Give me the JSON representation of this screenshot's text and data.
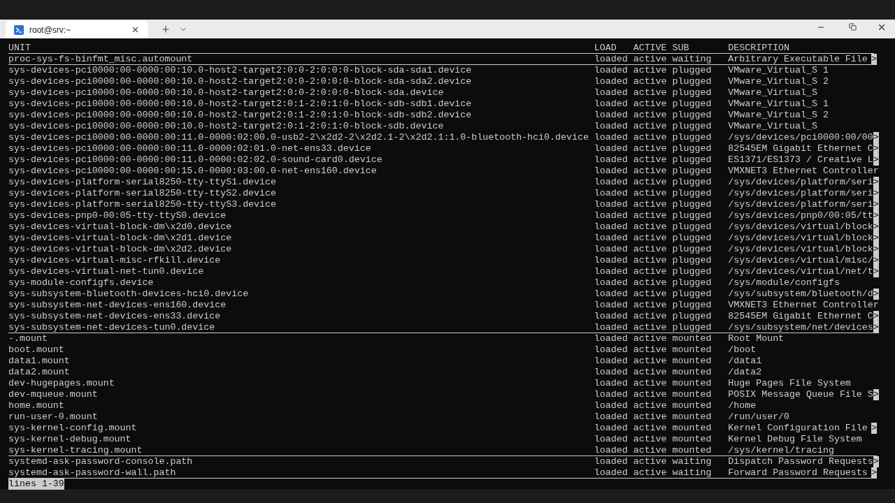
{
  "tab": {
    "title": "root@srv:~",
    "selected": true
  },
  "table": {
    "columns": [
      "UNIT",
      "LOAD",
      "ACTIVE",
      "SUB",
      "DESCRIPTION"
    ],
    "header_underlined": true,
    "rows": [
      {
        "unit": "proc-sys-fs-binfmt_misc.automount",
        "load": "loaded",
        "active": "active",
        "sub": "waiting",
        "description": "Arbitrary Executable File",
        "more": ">",
        "underlined": true
      },
      {
        "unit": "sys-devices-pci0000:00-0000:00:10.0-host2-target2:0:0-2:0:0:0-block-sda-sda1.device",
        "load": "loaded",
        "active": "active",
        "sub": "plugged",
        "description": "VMware_Virtual_S 1",
        "underlined": false
      },
      {
        "unit": "sys-devices-pci0000:00-0000:00:10.0-host2-target2:0:0-2:0:0:0-block-sda-sda2.device",
        "load": "loaded",
        "active": "active",
        "sub": "plugged",
        "description": "VMware_Virtual_S 2",
        "underlined": false
      },
      {
        "unit": "sys-devices-pci0000:00-0000:00:10.0-host2-target2:0:0-2:0:0:0-block-sda.device",
        "load": "loaded",
        "active": "active",
        "sub": "plugged",
        "description": "VMware_Virtual_S",
        "underlined": false
      },
      {
        "unit": "sys-devices-pci0000:00-0000:00:10.0-host2-target2:0:1-2:0:1:0-block-sdb-sdb1.device",
        "load": "loaded",
        "active": "active",
        "sub": "plugged",
        "description": "VMware_Virtual_S 1",
        "underlined": false
      },
      {
        "unit": "sys-devices-pci0000:00-0000:00:10.0-host2-target2:0:1-2:0:1:0-block-sdb-sdb2.device",
        "load": "loaded",
        "active": "active",
        "sub": "plugged",
        "description": "VMware_Virtual_S 2",
        "underlined": false
      },
      {
        "unit": "sys-devices-pci0000:00-0000:00:10.0-host2-target2:0:1-2:0:1:0-block-sdb.device",
        "load": "loaded",
        "active": "active",
        "sub": "plugged",
        "description": "VMware_Virtual_S",
        "underlined": false
      },
      {
        "unit": "sys-devices-pci0000:00-0000:00:11.0-0000:02:00.0-usb2-2\\x2d2-2\\x2d2.1-2\\x2d2.1:1.0-bluetooth-hci0.device",
        "load": "loaded",
        "active": "active",
        "sub": "plugged",
        "description": "/sys/devices/pci0000:00/00",
        "more": ">",
        "underlined": false
      },
      {
        "unit": "sys-devices-pci0000:00-0000:00:11.0-0000:02:01.0-net-ens33.device",
        "load": "loaded",
        "active": "active",
        "sub": "plugged",
        "description": "82545EM Gigabit Ethernet C",
        "more": ">",
        "underlined": false
      },
      {
        "unit": "sys-devices-pci0000:00-0000:00:11.0-0000:02:02.0-sound-card0.device",
        "load": "loaded",
        "active": "active",
        "sub": "plugged",
        "description": "ES1371/ES1373 / Creative L",
        "more": ">",
        "underlined": false
      },
      {
        "unit": "sys-devices-pci0000:00-0000:00:15.0-0000:03:00.0-net-ens160.device",
        "load": "loaded",
        "active": "active",
        "sub": "plugged",
        "description": "VMXNET3 Ethernet Controller",
        "underlined": false
      },
      {
        "unit": "sys-devices-platform-serial8250-tty-ttyS1.device",
        "load": "loaded",
        "active": "active",
        "sub": "plugged",
        "description": "/sys/devices/platform/seri",
        "more": ">",
        "underlined": false
      },
      {
        "unit": "sys-devices-platform-serial8250-tty-ttyS2.device",
        "load": "loaded",
        "active": "active",
        "sub": "plugged",
        "description": "/sys/devices/platform/seri",
        "more": ">",
        "underlined": false
      },
      {
        "unit": "sys-devices-platform-serial8250-tty-ttyS3.device",
        "load": "loaded",
        "active": "active",
        "sub": "plugged",
        "description": "/sys/devices/platform/seri",
        "more": ">",
        "underlined": false
      },
      {
        "unit": "sys-devices-pnp0-00:05-tty-ttyS0.device",
        "load": "loaded",
        "active": "active",
        "sub": "plugged",
        "description": "/sys/devices/pnp0/00:05/tt",
        "more": ">",
        "underlined": false
      },
      {
        "unit": "sys-devices-virtual-block-dm\\x2d0.device",
        "load": "loaded",
        "active": "active",
        "sub": "plugged",
        "description": "/sys/devices/virtual/block",
        "more": ">",
        "underlined": false
      },
      {
        "unit": "sys-devices-virtual-block-dm\\x2d1.device",
        "load": "loaded",
        "active": "active",
        "sub": "plugged",
        "description": "/sys/devices/virtual/block",
        "more": ">",
        "underlined": false
      },
      {
        "unit": "sys-devices-virtual-block-dm\\x2d2.device",
        "load": "loaded",
        "active": "active",
        "sub": "plugged",
        "description": "/sys/devices/virtual/block",
        "more": ">",
        "underlined": false
      },
      {
        "unit": "sys-devices-virtual-misc-rfkill.device",
        "load": "loaded",
        "active": "active",
        "sub": "plugged",
        "description": "/sys/devices/virtual/misc/",
        "more": ">",
        "underlined": false
      },
      {
        "unit": "sys-devices-virtual-net-tun0.device",
        "load": "loaded",
        "active": "active",
        "sub": "plugged",
        "description": "/sys/devices/virtual/net/t",
        "more": ">",
        "underlined": false
      },
      {
        "unit": "sys-module-configfs.device",
        "load": "loaded",
        "active": "active",
        "sub": "plugged",
        "description": "/sys/module/configfs",
        "underlined": false
      },
      {
        "unit": "sys-subsystem-bluetooth-devices-hci0.device",
        "load": "loaded",
        "active": "active",
        "sub": "plugged",
        "description": "/sys/subsystem/bluetooth/d",
        "more": ">",
        "underlined": false
      },
      {
        "unit": "sys-subsystem-net-devices-ens160.device",
        "load": "loaded",
        "active": "active",
        "sub": "plugged",
        "description": "VMXNET3 Ethernet Controller",
        "underlined": false
      },
      {
        "unit": "sys-subsystem-net-devices-ens33.device",
        "load": "loaded",
        "active": "active",
        "sub": "plugged",
        "description": "82545EM Gigabit Ethernet C",
        "more": ">",
        "underlined": false
      },
      {
        "unit": "sys-subsystem-net-devices-tun0.device",
        "load": "loaded",
        "active": "active",
        "sub": "plugged",
        "description": "/sys/subsystem/net/devices",
        "more": ">",
        "underlined": true
      },
      {
        "unit": "-.mount",
        "load": "loaded",
        "active": "active",
        "sub": "mounted",
        "description": "Root Mount",
        "underlined": false
      },
      {
        "unit": "boot.mount",
        "load": "loaded",
        "active": "active",
        "sub": "mounted",
        "description": "/boot",
        "underlined": false
      },
      {
        "unit": "data1.mount",
        "load": "loaded",
        "active": "active",
        "sub": "mounted",
        "description": "/data1",
        "underlined": false
      },
      {
        "unit": "data2.mount",
        "load": "loaded",
        "active": "active",
        "sub": "mounted",
        "description": "/data2",
        "underlined": false
      },
      {
        "unit": "dev-hugepages.mount",
        "load": "loaded",
        "active": "active",
        "sub": "mounted",
        "description": "Huge Pages File System",
        "underlined": false
      },
      {
        "unit": "dev-mqueue.mount",
        "load": "loaded",
        "active": "active",
        "sub": "mounted",
        "description": "POSIX Message Queue File S",
        "more": ">",
        "underlined": false
      },
      {
        "unit": "home.mount",
        "load": "loaded",
        "active": "active",
        "sub": "mounted",
        "description": "/home",
        "underlined": false
      },
      {
        "unit": "run-user-0.mount",
        "load": "loaded",
        "active": "active",
        "sub": "mounted",
        "description": "/run/user/0",
        "underlined": false
      },
      {
        "unit": "sys-kernel-config.mount",
        "load": "loaded",
        "active": "active",
        "sub": "mounted",
        "description": "Kernel Configuration File",
        "more": ">",
        "underlined": false
      },
      {
        "unit": "sys-kernel-debug.mount",
        "load": "loaded",
        "active": "active",
        "sub": "mounted",
        "description": "Kernel Debug File System",
        "underlined": false
      },
      {
        "unit": "sys-kernel-tracing.mount",
        "load": "loaded",
        "active": "active",
        "sub": "mounted",
        "description": "/sys/kernel/tracing",
        "underlined": true
      },
      {
        "unit": "systemd-ask-password-console.path",
        "load": "loaded",
        "active": "active",
        "sub": "waiting",
        "description": "Dispatch Password Requests",
        "more": ">",
        "underlined": false
      },
      {
        "unit": "systemd-ask-password-wall.path",
        "load": "loaded",
        "active": "active",
        "sub": "waiting",
        "description": "Forward Password Requests",
        "more": ">",
        "underlined": true
      }
    ]
  },
  "pager_status": "lines 1-39"
}
